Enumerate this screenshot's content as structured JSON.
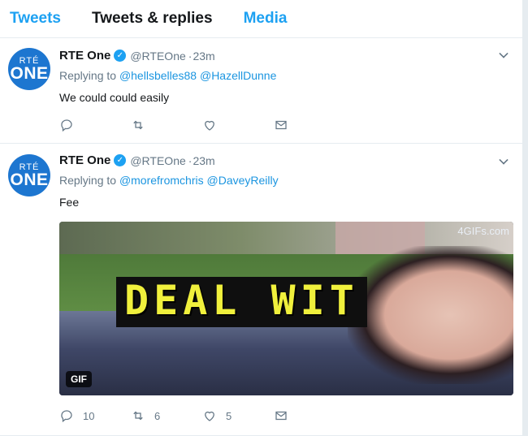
{
  "tabs": [
    {
      "label": "Tweets"
    },
    {
      "label": "Tweets & replies"
    },
    {
      "label": "Media"
    }
  ],
  "tweets": [
    {
      "avatar_top": "RTÉ",
      "avatar_bottom": "ONE",
      "name": "RTE One",
      "handle": "@RTEOne",
      "time": "23m",
      "replying_prefix": "Replying to",
      "mentions": [
        "@hellsbelles88",
        "@HazellDunne"
      ],
      "text": "We could could easily",
      "counts": {
        "reply": "",
        "retweet": "",
        "like": ""
      }
    },
    {
      "avatar_top": "RTÉ",
      "avatar_bottom": "ONE",
      "name": "RTE One",
      "handle": "@RTEOne",
      "time": "23m",
      "replying_prefix": "Replying to",
      "mentions": [
        "@morefromchris",
        "@DaveyReilly"
      ],
      "text": "Fee",
      "media": {
        "caption": "DEAL WIT",
        "watermark": "4GIFs.com",
        "badge": "GIF"
      },
      "counts": {
        "reply": "10",
        "retweet": "6",
        "like": "5"
      }
    }
  ],
  "icons": [
    "reply-icon",
    "retweet-icon",
    "like-icon",
    "message-icon",
    "verified-icon",
    "chevron-down-icon"
  ],
  "colors": {
    "accent": "#1da1f2",
    "muted": "#657786",
    "avatar": "#1d76d0"
  }
}
